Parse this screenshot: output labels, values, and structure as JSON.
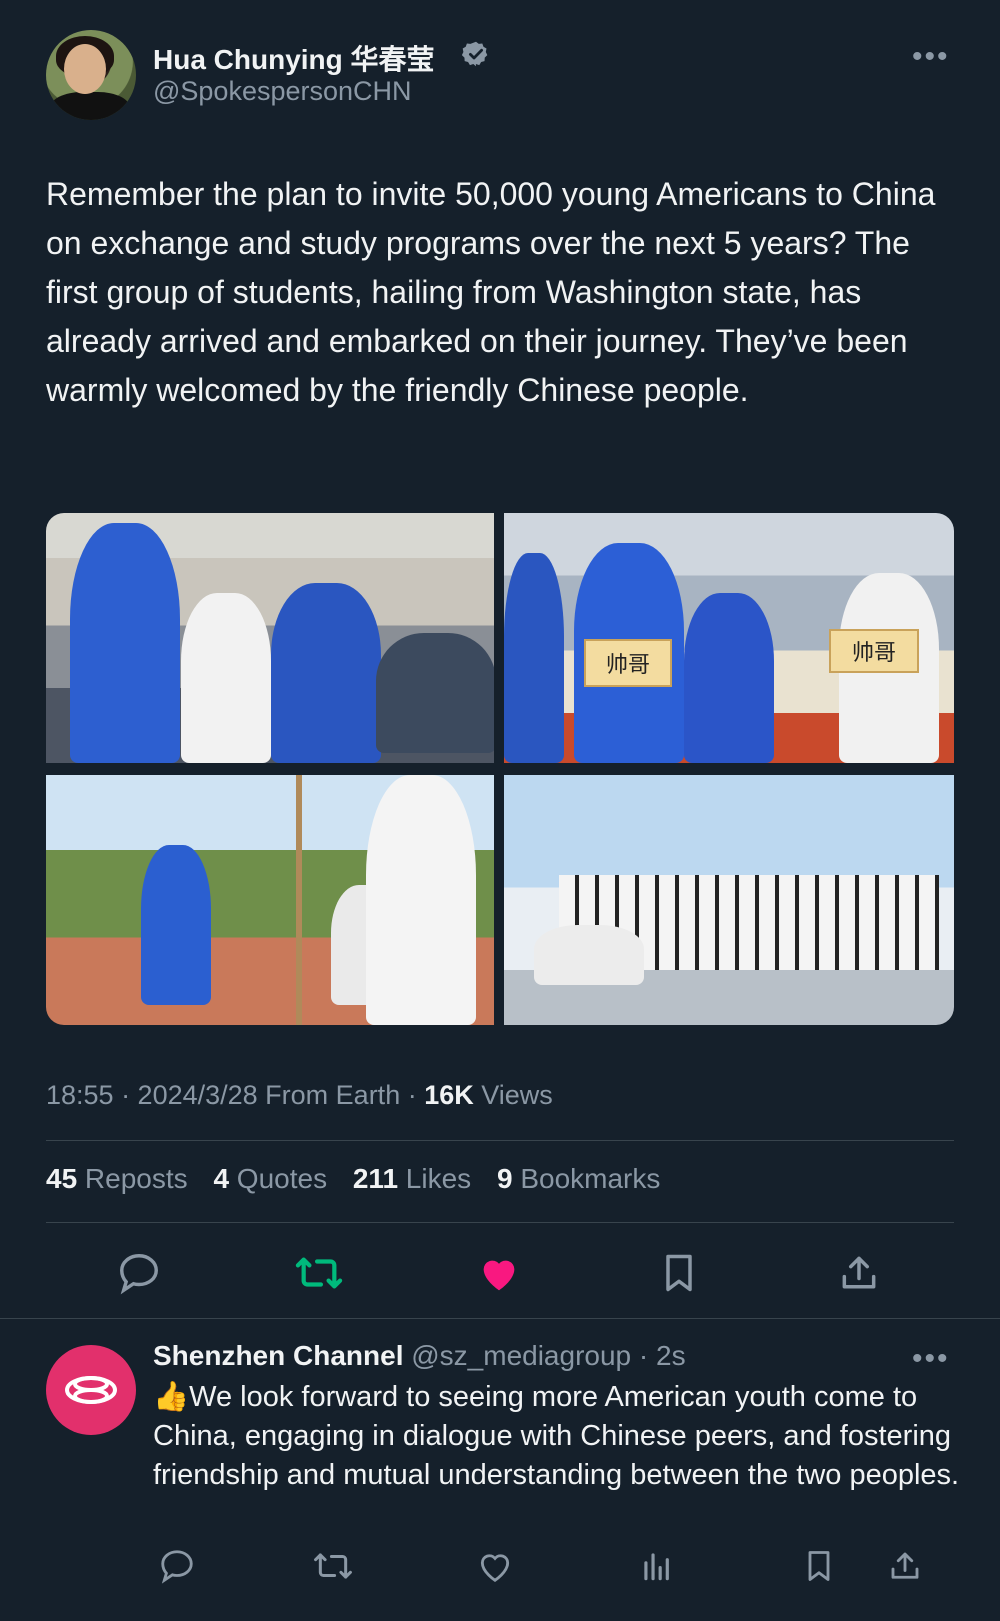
{
  "tweet": {
    "author": {
      "display_name": "Hua Chunying 华春莹",
      "handle": "@SpokespersonCHN",
      "verified": true,
      "avatar": "avatar"
    },
    "more_icon": "more-icon",
    "text": "Remember the plan to invite 50,000 young Americans to China on exchange and study programs over the next 5 years? The first group of students, hailing from Washington state, has already arrived and embarked on their journey. They’ve been warmly welcomed by the friendly Chinese people.",
    "photo_signs": [
      "帅哥",
      "帅哥"
    ],
    "meta": {
      "time_date_source": "18:55 · 2024/3/28 From Earth · ",
      "views_count": "16K",
      "views_label": " Views"
    },
    "stats": [
      {
        "count": "45",
        "label": " Reposts"
      },
      {
        "count": "4",
        "label": " Quotes"
      },
      {
        "count": "211",
        "label": " Likes"
      },
      {
        "count": "9",
        "label": " Bookmarks"
      }
    ],
    "actions": [
      "reply-icon",
      "repost-icon",
      "like-icon",
      "bookmark-icon",
      "share-icon"
    ],
    "colors": {
      "repost_active": "#00ba7c",
      "like_active": "#f91880",
      "background": "#15202b",
      "secondary_text": "#8b98a5"
    }
  },
  "reply": {
    "display_name": "Shenzhen Channel",
    "handle_time": " @sz_mediagroup · 2s",
    "text": "👍We look forward to seeing more American youth come to China, engaging in dialogue with Chinese peers, and fostering friendship and mutual understanding between the two peoples.",
    "actions": [
      "reply-icon",
      "repost-icon",
      "like-icon",
      "views-icon",
      "bookmark-icon",
      "share-icon"
    ],
    "avatar_color": "#e2306c"
  }
}
